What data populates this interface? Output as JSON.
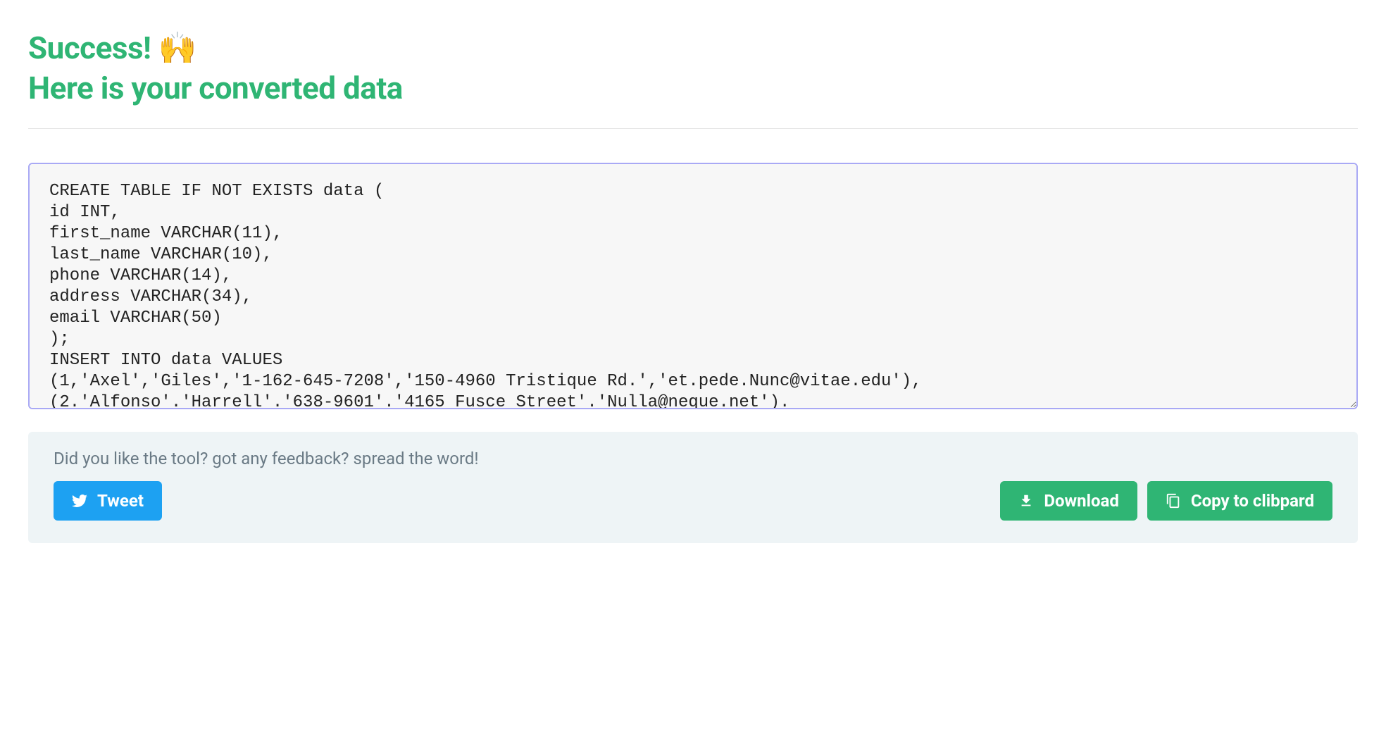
{
  "header": {
    "line1": "Success! 🙌",
    "line2": "Here is your converted data"
  },
  "output": {
    "value": "CREATE TABLE IF NOT EXISTS data (\nid INT,\nfirst_name VARCHAR(11),\nlast_name VARCHAR(10),\nphone VARCHAR(14),\naddress VARCHAR(34),\nemail VARCHAR(50)\n);\nINSERT INTO data VALUES\n(1,'Axel','Giles','1-162-645-7208','150-4960 Tristique Rd.','et.pede.Nunc@vitae.edu'),\n(2.'Alfonso'.'Harrell'.'638-9601'.'4165 Fusce Street'.'Nulla@neque.net')."
  },
  "footer": {
    "feedback_text": "Did you like the tool? got any feedback? spread the word!",
    "tweet_label": "Tweet",
    "download_label": "Download",
    "copy_label": "Copy to clibpard"
  }
}
